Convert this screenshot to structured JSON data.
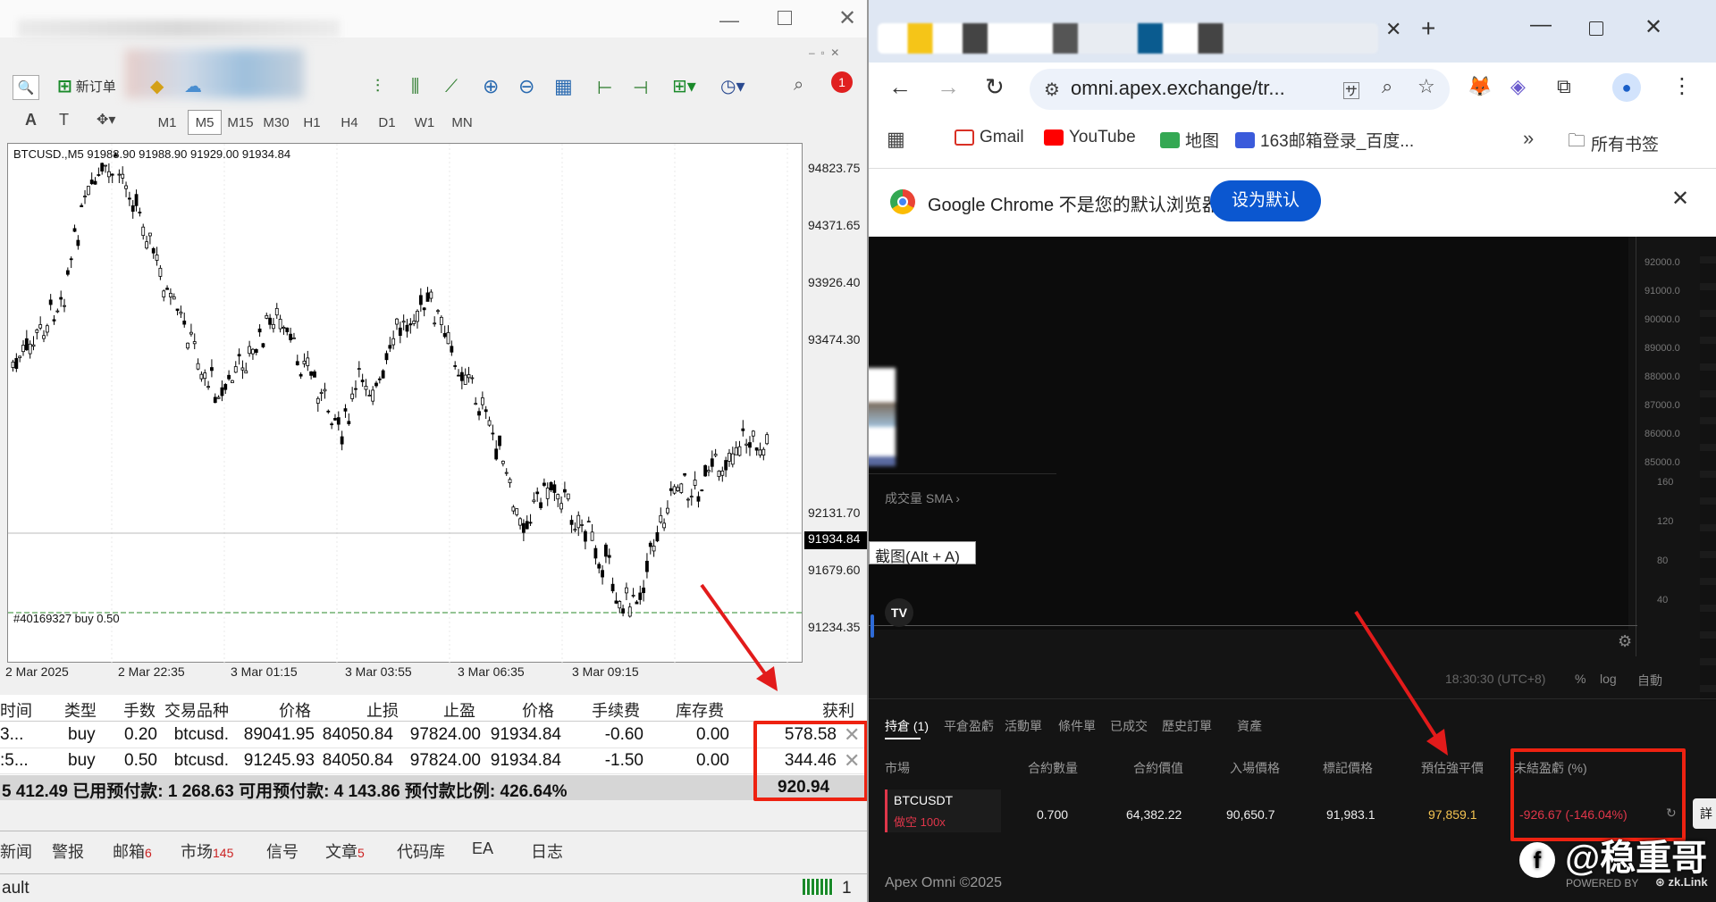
{
  "mt": {
    "new_order": "新订单",
    "timeframes": [
      "M1",
      "M5",
      "M15",
      "M30",
      "H1",
      "H4",
      "D1",
      "W1",
      "MN"
    ],
    "notify_count": "1",
    "chart_header": "BTCUSD.,M5  91988.90 91988.90 91929.00 91934.84",
    "price_labels": [
      "94823.75",
      "94371.65",
      "93926.40",
      "93474.30",
      "92131.70",
      "91679.60",
      "91234.35"
    ],
    "current_price": "91934.84",
    "order_line_label": "#40169327 buy 0.50",
    "time_labels": [
      "2 Mar 2025",
      "2 Mar 22:35",
      "3 Mar 01:15",
      "3 Mar 03:55",
      "3 Mar 06:35",
      "3 Mar 09:15"
    ],
    "table": {
      "headers": [
        "时间",
        "类型",
        "手数",
        "交易品种",
        "价格",
        "止损",
        "止盈",
        "价格",
        "手续费",
        "库存费",
        "获利"
      ],
      "rows": [
        [
          "3...",
          "buy",
          "0.20",
          "btcusd.",
          "89041.95",
          "84050.84",
          "97824.00",
          "91934.84",
          "-0.60",
          "0.00",
          "578.58"
        ],
        [
          ":5...",
          "buy",
          "0.50",
          "btcusd.",
          "91245.93",
          "84050.84",
          "97824.00",
          "91934.84",
          "-1.50",
          "0.00",
          "344.46"
        ]
      ],
      "summary": "5 412.49  已用预付款: 1 268.63  可用预付款: 4 143.86  预付款比例: 426.64%",
      "total_profit": "920.94"
    },
    "bottom_tabs": [
      {
        "label": "新闻",
        "badge": ""
      },
      {
        "label": "警报",
        "badge": ""
      },
      {
        "label": "邮箱",
        "badge": "6"
      },
      {
        "label": "市场",
        "badge": "145"
      },
      {
        "label": "信号",
        "badge": ""
      },
      {
        "label": "文章",
        "badge": "5"
      },
      {
        "label": "代码库",
        "badge": ""
      },
      {
        "label": "EA",
        "badge": ""
      },
      {
        "label": "日志",
        "badge": ""
      }
    ],
    "status_left": "ault",
    "status_right": "1"
  },
  "browser": {
    "url": "omni.apex.exchange/tr...",
    "bookmarks": [
      "Gmail",
      "YouTube",
      "地图",
      "163邮箱登录_百度...",
      "所有书签"
    ],
    "default_msg": "Google Chrome 不是您的默认浏览器",
    "default_btn": "设为默认",
    "screenshot_tip": "截图(Alt + A)",
    "volume_label": "成交量 SMA",
    "y_labels": [
      "92000.0",
      "91000.0",
      "90000.0",
      "89000.0",
      "88000.0",
      "87000.0",
      "86000.0",
      "85000.0",
      "160",
      "120",
      "80",
      "40"
    ],
    "time_readout": "18:30:30 (UTC+8)",
    "scale_opts": [
      "%",
      "log",
      "自動"
    ],
    "pos_tabs": [
      "持倉 (1)",
      "平倉盈虧",
      "活動單",
      "條件單",
      "已成交",
      "歷史訂單",
      "資產"
    ],
    "pos_headers": [
      "市場",
      "合約數量",
      "合約價值",
      "入場價格",
      "標記價格",
      "預估強平價",
      "未結盈虧 (%)"
    ],
    "pos_row": {
      "market": "BTCUSDT",
      "side": "做空 100x",
      "qty": "0.700",
      "value": "64,382.22",
      "entry": "90,650.7",
      "mark": "91,983.1",
      "liq": "97,859.1",
      "pnl": "-926.67 (-146.04%)"
    },
    "footer": "Apex Omni ©2025",
    "powered": "POWERED BY",
    "zk": "zk.Link",
    "watermark": "@稳重哥"
  },
  "colors": {
    "accent_blue": "#1a73e8",
    "loss_red": "#e0364a",
    "liq_yellow": "#f5c451",
    "annot_red": "#e21b1b"
  }
}
